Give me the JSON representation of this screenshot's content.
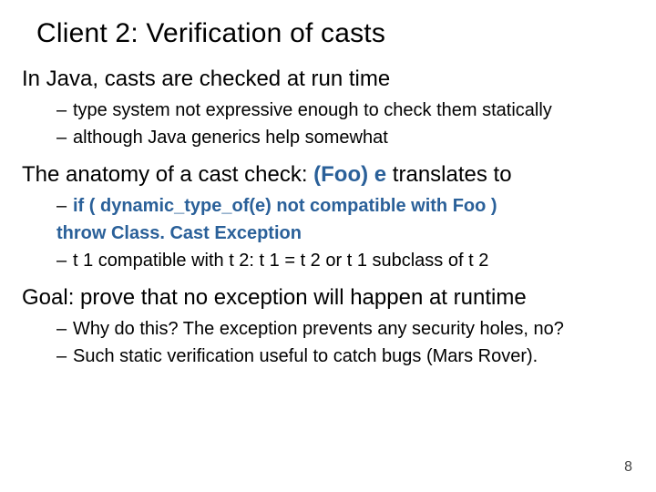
{
  "title": "Client 2: Verification of casts",
  "point1": {
    "text": "In Java, casts are checked at run time",
    "subs": [
      "type system not expressive enough to check them statically",
      "although Java generics help somewhat"
    ]
  },
  "point2": {
    "prefix": "The anatomy of a cast check: ",
    "code": "(Foo) e",
    "suffix": "  translates to",
    "sub_if_a": "if ( dynamic_type_of(e) not compatible with Foo )",
    "sub_if_b": "throw Class. Cast Exception",
    "sub_compat": "t 1 compatible with t 2: t 1 = t 2 or t 1 subclass of t 2"
  },
  "point3": {
    "text": "Goal: prove that no exception will happen at runtime",
    "subs": [
      "Why do this?  The exception prevents any security holes, no?",
      "Such static verification useful to catch bugs (Mars Rover)."
    ]
  },
  "page_number": "8"
}
